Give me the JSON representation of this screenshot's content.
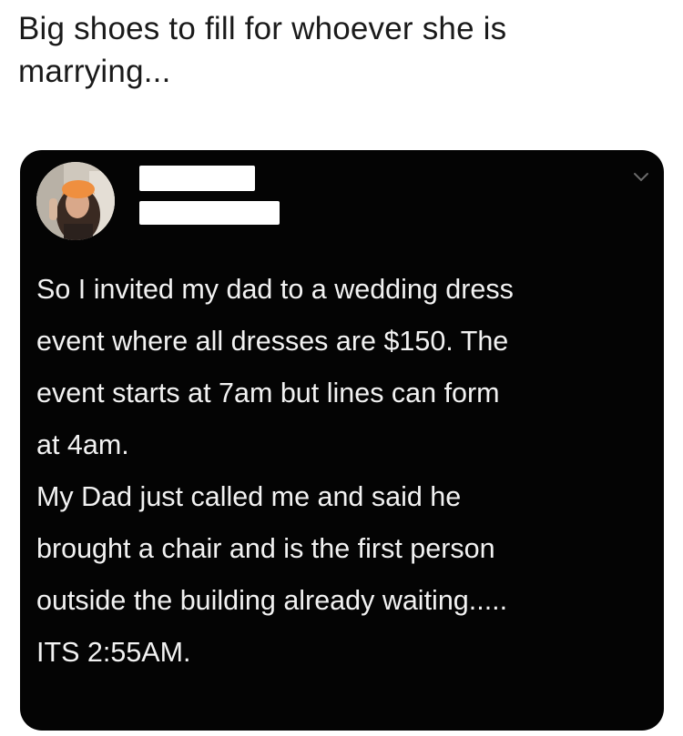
{
  "caption": {
    "text": "Big shoes to fill for whoever she is\nmarrying..."
  },
  "post": {
    "avatar_icon": "profile-photo",
    "menu_icon": "chevron-down-icon",
    "body": "So I invited my dad to a wedding dress\nevent where all dresses are $150. The\nevent starts at 7am but lines can form\nat 4am.\nMy Dad just called me and said he\nbrought a chair and is the first person\noutside the building already waiting.....\nITS 2:55AM.",
    "colors": {
      "background": "#040404",
      "text": "#f2f2f2",
      "redaction": "#ffffff"
    }
  }
}
